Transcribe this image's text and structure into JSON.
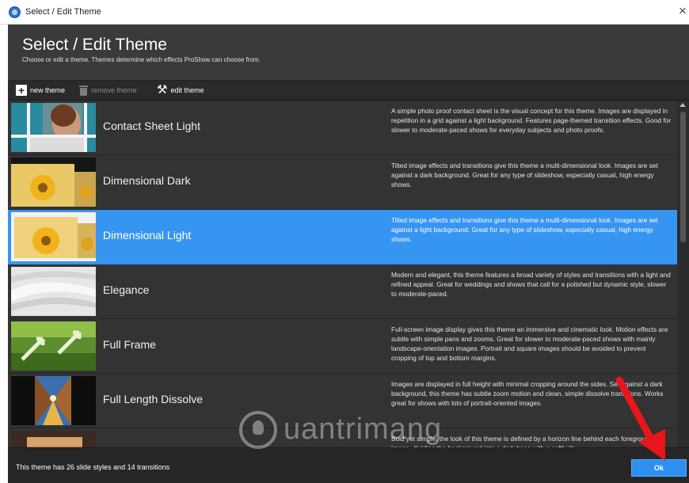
{
  "window": {
    "title": "Select / Edit Theme",
    "close_glyph": "×",
    "app_icon": "proshow-app-icon"
  },
  "header": {
    "title": "Select / Edit Theme",
    "subtitle": "Choose or edit a theme. Themes determine which effects ProShow can choose from."
  },
  "toolbar": {
    "new_theme": "new theme",
    "remove_theme": "remove theme",
    "edit_theme": "edit theme",
    "icons": [
      "plus-icon",
      "trash-icon",
      "tools-icon"
    ]
  },
  "themes": [
    {
      "name": "Contact Sheet Light",
      "description": "A simple photo proof contact sheet is the visual concept for this theme. Images are displayed in repetition in a grid against a light background. Features page-themed transition effects. Good for slower to moderate-paced shows for everyday subjects and photo proofs.",
      "selected": false
    },
    {
      "name": "Dimensional Dark",
      "description": "Tilted image effects and transitions give this theme a multi-dimensional look. Images are set against a dark background. Great for any type of slideshow, especially casual, high energy shows.",
      "selected": false
    },
    {
      "name": "Dimensional Light",
      "description": "Tilted image effects and transitions give this theme a multi-dimensional look. Images are set against a light background. Great for any type of slideshow, especially casual, high energy shows.",
      "selected": true
    },
    {
      "name": "Elegance",
      "description": "Modern and elegant, this theme features a broad variety of styles and transitions with a light and refined appeal. Great for weddings and shows that call for a polished but dynamic style, slower to moderate-paced.",
      "selected": false
    },
    {
      "name": "Full Frame",
      "description": "Full-screen image display gives this theme an immersive and cinematic look. Motion effects are subtle with simple pans and zooms. Great for slower to moderate-paced shows with mainly landscape-orientation images. Portrait and square images should be avoided to prevent cropping of top and bottom margins.",
      "selected": false
    },
    {
      "name": "Full Length Dissolve",
      "description": "Images are displayed in full height with minimal cropping around the sides. Set against a dark background, this theme has subtle zoom motion and clean, simple dissolve transitions. Works great for shows with lots of portrait-oriented images.",
      "selected": false
    },
    {
      "name": "",
      "description": "Bold yet simple, the look of this theme is defined by a horizon line behind each foreground image, dividing the background into a dark base with a softly lit",
      "selected": false
    }
  ],
  "footer": {
    "status": "This theme has 26 slide styles and 14 transitions",
    "ok_label": "Ok"
  },
  "watermark": {
    "text": "uantrimang"
  },
  "colors": {
    "selection": "#3795f2",
    "ok_button": "#2d8ff0",
    "annotation_arrow": "#e8151b"
  }
}
